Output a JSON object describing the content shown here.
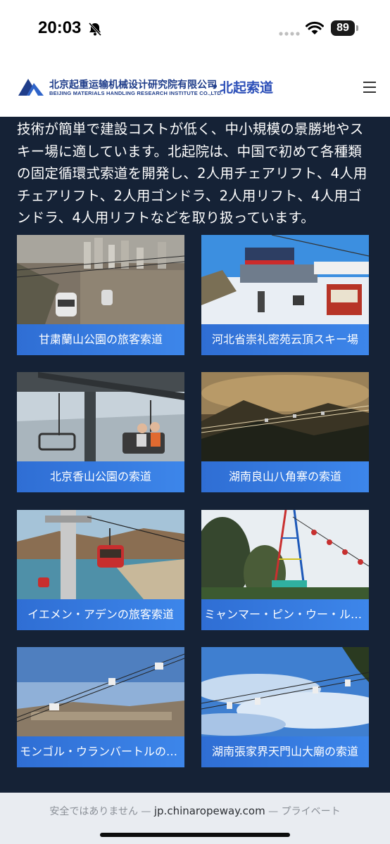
{
  "status_bar": {
    "time": "20:03",
    "battery": "89",
    "icons": [
      "bell-slash-icon",
      "signal-dots-icon",
      "wifi-icon",
      "battery-icon"
    ]
  },
  "header": {
    "company_cn": "北京起重运输机械设计研究院有限公司",
    "company_en": "BEIJING MATERIALS HANDLING RESEARCH INSTITUTE CO.,LTD.",
    "brand": "北起索道",
    "menu_icon": "hamburger-menu-icon"
  },
  "intro": {
    "text": "技術が簡単で建設コストが低く、中小規模の景勝地やスキー場に適しています。北起院は、中国で初めて各種類の固定循環式索道を開発し、2人用チェアリフト、4人用チェアリフト、2人用ゴンドラ、2人用リフト、4人用ゴンドラ、4人用リフトなどを取り扱っています。"
  },
  "projects": [
    {
      "caption": "甘粛蘭山公園の旅客索道"
    },
    {
      "caption": "河北省崇礼密苑云頂スキー場"
    },
    {
      "caption": "北京香山公園の索道"
    },
    {
      "caption": "湖南良山八角寨の索道"
    },
    {
      "caption": "イエメン・アデンの旅客索道"
    },
    {
      "caption": "ミャンマー・ピン・ウー・ルウィン"
    },
    {
      "caption": "モンゴル・ウランバートルのスキー場"
    },
    {
      "caption": "湖南張家界天門山大廟の索道"
    }
  ],
  "browser": {
    "security": "安全ではありません —",
    "domain": "jp.chinaropeway.com",
    "mode": "— プライベート"
  },
  "colors": {
    "page_background": "#152236",
    "caption_blue": "#3d86ea",
    "brand_blue": "#1f3d8a"
  }
}
